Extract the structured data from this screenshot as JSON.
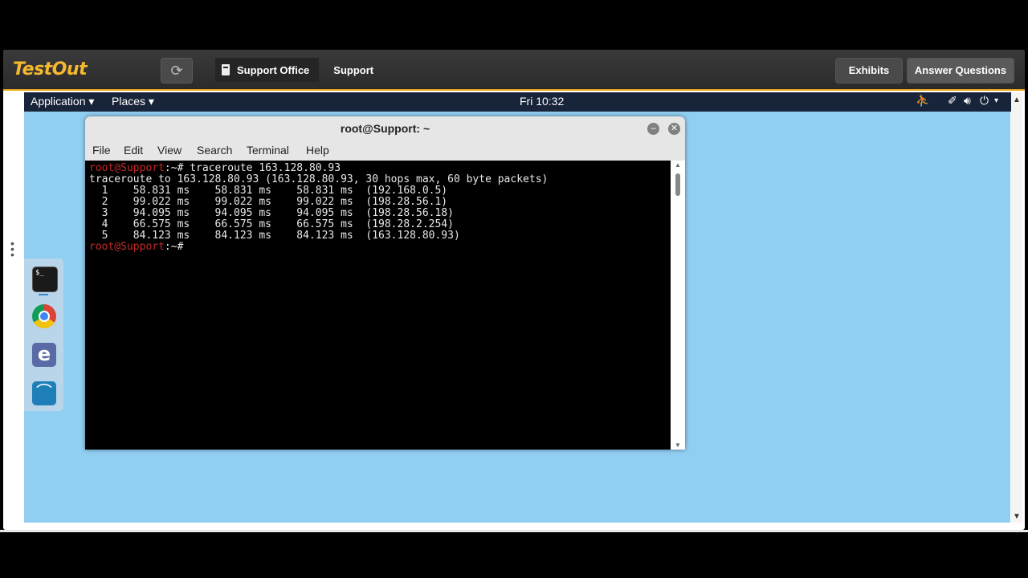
{
  "topbar": {
    "logo": "TestOut",
    "refresh_icon": "refresh-icon",
    "breadcrumb": [
      "Support Office",
      "Support"
    ],
    "exhibits_label": "Exhibits",
    "answer_label": "Answer Questions"
  },
  "desktop": {
    "panel": {
      "application_menu": "Application ▾",
      "places_menu": "Places ▾",
      "clock": "Fri 10:32",
      "tray_icons": [
        "users-icon",
        "network-icon",
        "volume-icon",
        "power-icon"
      ]
    },
    "dock": {
      "apps": [
        "terminal-icon",
        "chrome-icon",
        "editor-icon",
        "wireshark-icon"
      ],
      "terminal_glyph": "$_"
    }
  },
  "terminal": {
    "title": "root@Support: ~",
    "menu": [
      "File",
      "Edit",
      "View",
      "Search",
      "Terminal",
      "Help"
    ],
    "prompt_user": "root@Support",
    "prompt_suffix": ":~#",
    "command": " traceroute 163.128.80.93",
    "output": [
      "traceroute to 163.128.80.93 (163.128.80.93, 30 hops max, 60 byte packets)",
      "  1    58.831 ms    58.831 ms    58.831 ms  (192.168.0.5)",
      "  2    99.022 ms    99.022 ms    99.022 ms  (198.28.56.1)",
      "  3    94.095 ms    94.095 ms    94.095 ms  (198.28.56.18)",
      "  4    66.575 ms    66.575 ms    66.575 ms  (198.28.2.254)",
      "  5    84.123 ms    84.123 ms    84.123 ms  (163.128.80.93)"
    ]
  },
  "colors": {
    "topbar_accent": "#e8a317",
    "logo": "#f5b82e",
    "desktop_bg": "#91cff2",
    "prompt_user": "#c82828"
  }
}
